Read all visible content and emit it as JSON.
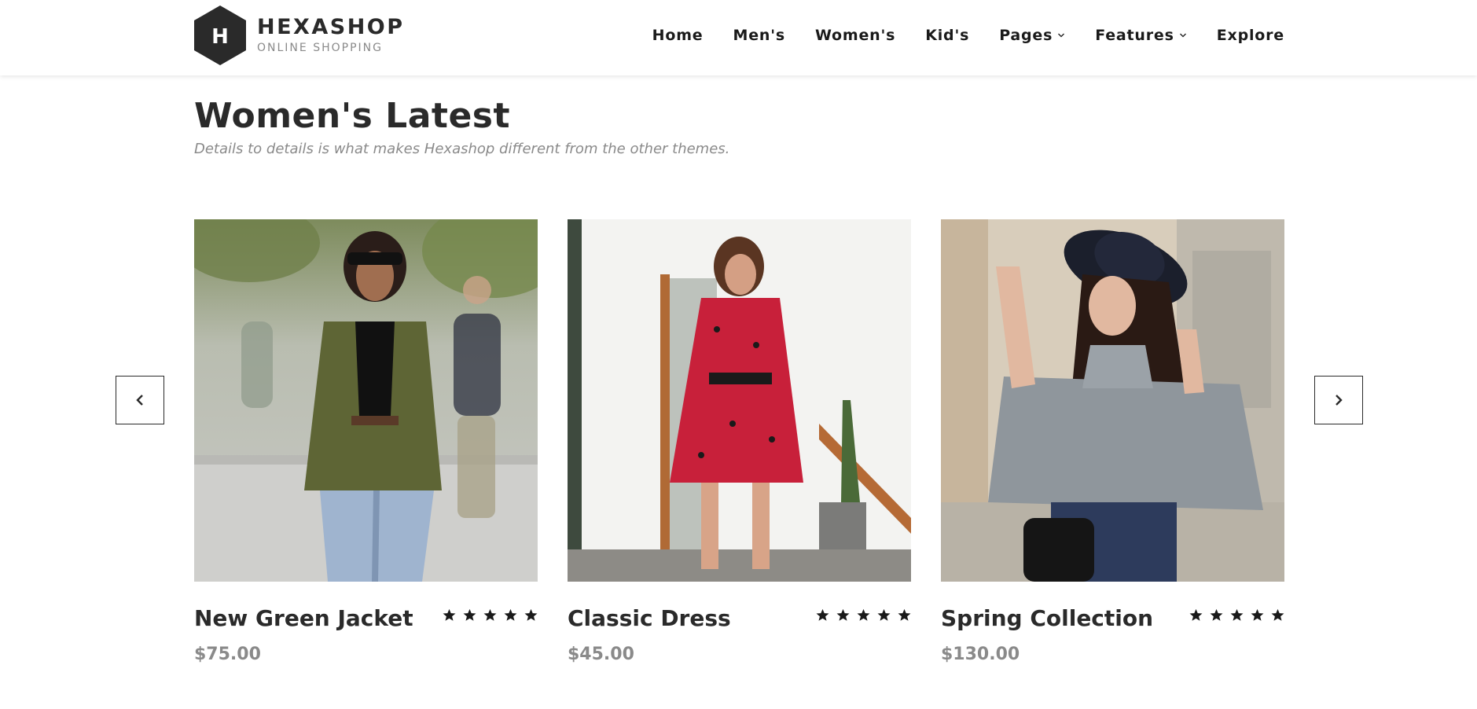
{
  "brand": {
    "letter": "H",
    "name": "HEXASHOP",
    "tagline": "ONLINE SHOPPING"
  },
  "nav": {
    "items": [
      {
        "label": "Home"
      },
      {
        "label": "Men's"
      },
      {
        "label": "Women's"
      },
      {
        "label": "Kid's"
      },
      {
        "label": "Pages",
        "has_dropdown": true
      },
      {
        "label": "Features",
        "has_dropdown": true
      },
      {
        "label": "Explore"
      }
    ]
  },
  "section": {
    "title": "Women's Latest",
    "subtitle": "Details to details is what makes Hexashop different from the other themes."
  },
  "carousel": {
    "prev_icon": "chevron-left-icon",
    "next_icon": "chevron-right-icon",
    "products": [
      {
        "name": "New Green Jacket",
        "price": "$75.00",
        "rating": 5
      },
      {
        "name": "Classic Dress",
        "price": "$45.00",
        "rating": 5
      },
      {
        "name": "Spring Collection",
        "price": "$130.00",
        "rating": 5
      }
    ]
  },
  "colors": {
    "text_dark": "#2a2a2a",
    "text_muted": "#8a8a8a",
    "logo_hex": "#2a2a2a"
  }
}
